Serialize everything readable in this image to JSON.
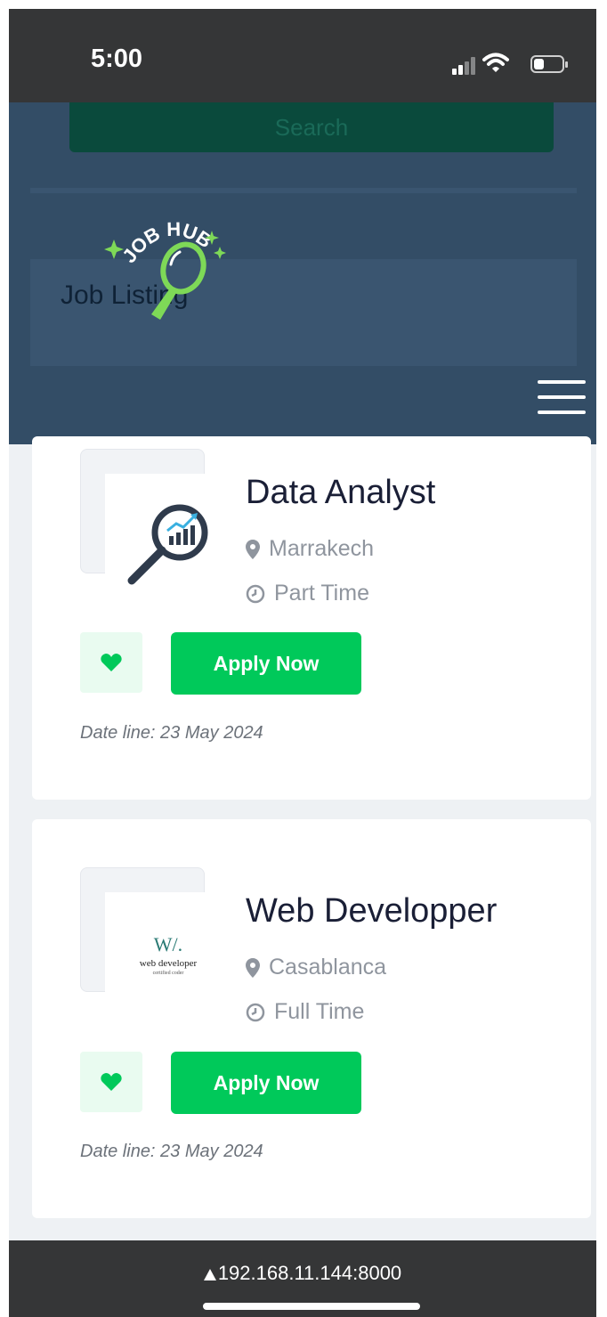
{
  "status_bar": {
    "time": "5:00"
  },
  "header": {
    "search_label": "Search",
    "logo_text": "JOB HUB",
    "page_heading": "Job Listing",
    "menu_icon": "hamburger-icon"
  },
  "jobs": [
    {
      "title": "Data Analyst",
      "location": "Marrakech",
      "type": "Part Time",
      "apply_label": "Apply Now",
      "deadline": "Date line: 23 May 2024",
      "logo": "magnifier-chart-icon"
    },
    {
      "title": "Web Developper",
      "location": "Casablanca",
      "type": "Full Time",
      "apply_label": "Apply Now",
      "deadline": "Date line: 23 May 2024",
      "logo_text": "W/.",
      "logo_caption": "web developer",
      "logo_subcaption": "certified coder"
    }
  ],
  "browser": {
    "url": "192.168.11.144:8000",
    "warning_icon": "warning-triangle-icon"
  },
  "colors": {
    "header": "#334d66",
    "accent": "#00c95a",
    "status_bar": "#353637",
    "logo_green": "#7ed957"
  }
}
